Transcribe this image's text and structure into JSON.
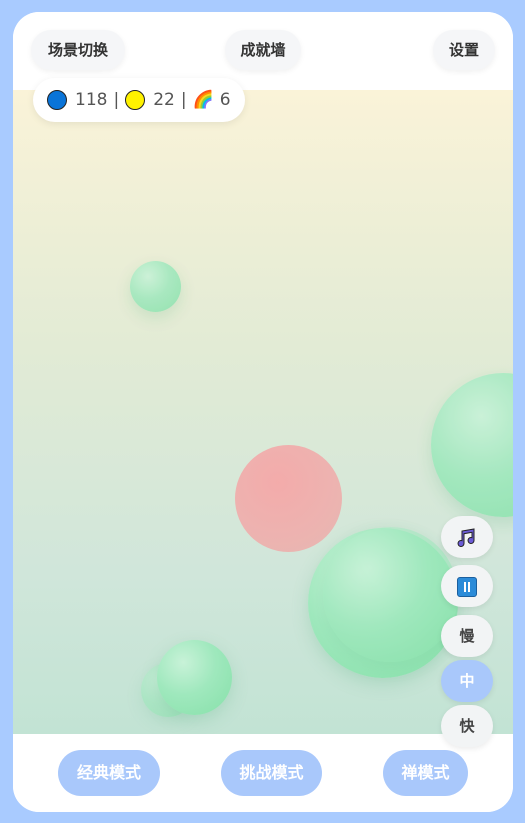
{
  "top_bar": {
    "scene_switch_label": "场景切换",
    "achievements_label": "成就墙",
    "settings_label": "设置"
  },
  "score": {
    "blue_count": "118",
    "yellow_count": "22",
    "rainbow_count": "6",
    "separator": "|",
    "blue_color": "#0a74d8",
    "yellow_color": "#fff200",
    "rainbow_glyph": "🌈"
  },
  "controls": {
    "music_icon": "music-note-icon",
    "pause_icon": "pause-icon",
    "speed_slow_label": "慢",
    "speed_medium_label": "中",
    "speed_fast_label": "快",
    "selected_speed": "中"
  },
  "modes": {
    "classic_label": "经典模式",
    "challenge_label": "挑战模式",
    "zen_label": "禅模式"
  },
  "colors": {
    "accent": "#a9c8fb",
    "page_background": "#a9cbff",
    "bubble_green": "#86e0a9",
    "bubble_red": "#f0a8a8"
  }
}
